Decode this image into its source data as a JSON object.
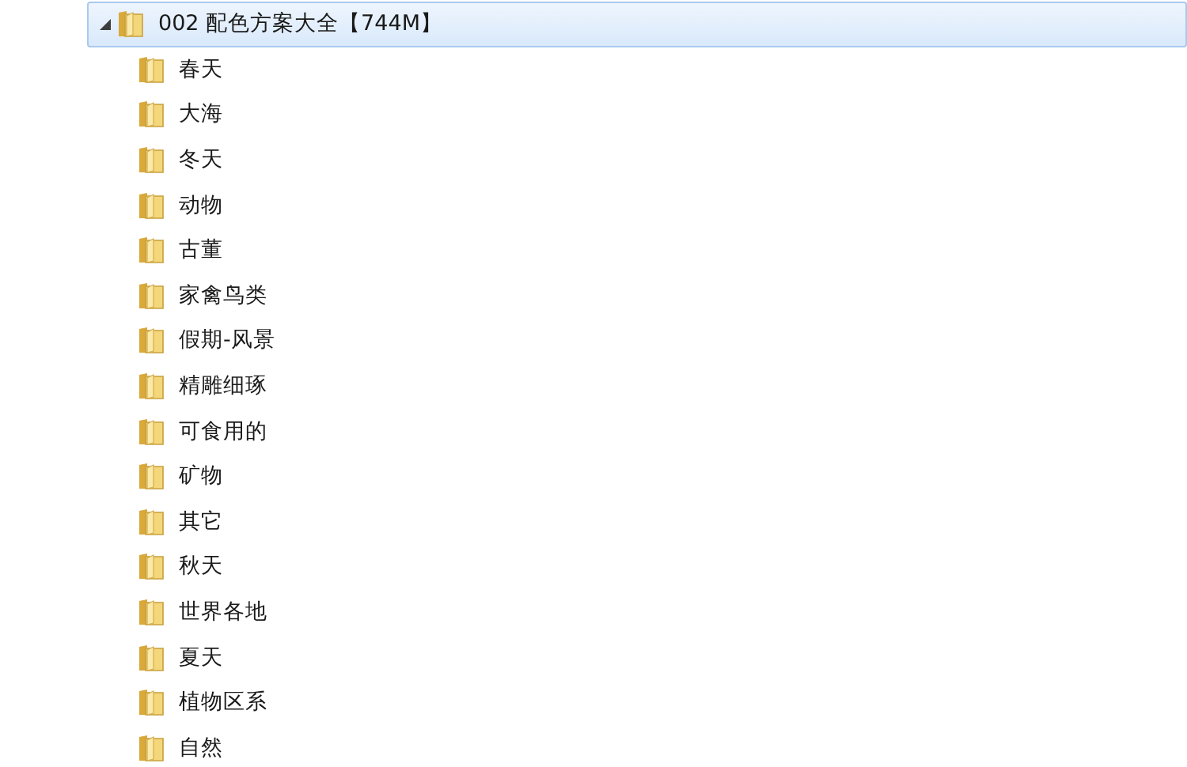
{
  "tree": {
    "label": "002 配色方案大全【744M】",
    "selected": true,
    "expanded": true,
    "children": [
      {
        "label": "春天",
        "selected": false
      },
      {
        "label": "大海",
        "selected": false
      },
      {
        "label": "冬天",
        "selected": false
      },
      {
        "label": "动物",
        "selected": false
      },
      {
        "label": "古董",
        "selected": false
      },
      {
        "label": "家禽鸟类",
        "selected": false
      },
      {
        "label": "假期-风景",
        "selected": false
      },
      {
        "label": "精雕细琢",
        "selected": false
      },
      {
        "label": "可食用的",
        "selected": false
      },
      {
        "label": "矿物",
        "selected": false
      },
      {
        "label": "其它",
        "selected": false
      },
      {
        "label": "秋天",
        "selected": false
      },
      {
        "label": "世界各地",
        "selected": false
      },
      {
        "label": "夏天",
        "selected": false
      },
      {
        "label": "植物区系",
        "selected": false
      },
      {
        "label": "自然",
        "selected": false
      }
    ]
  }
}
